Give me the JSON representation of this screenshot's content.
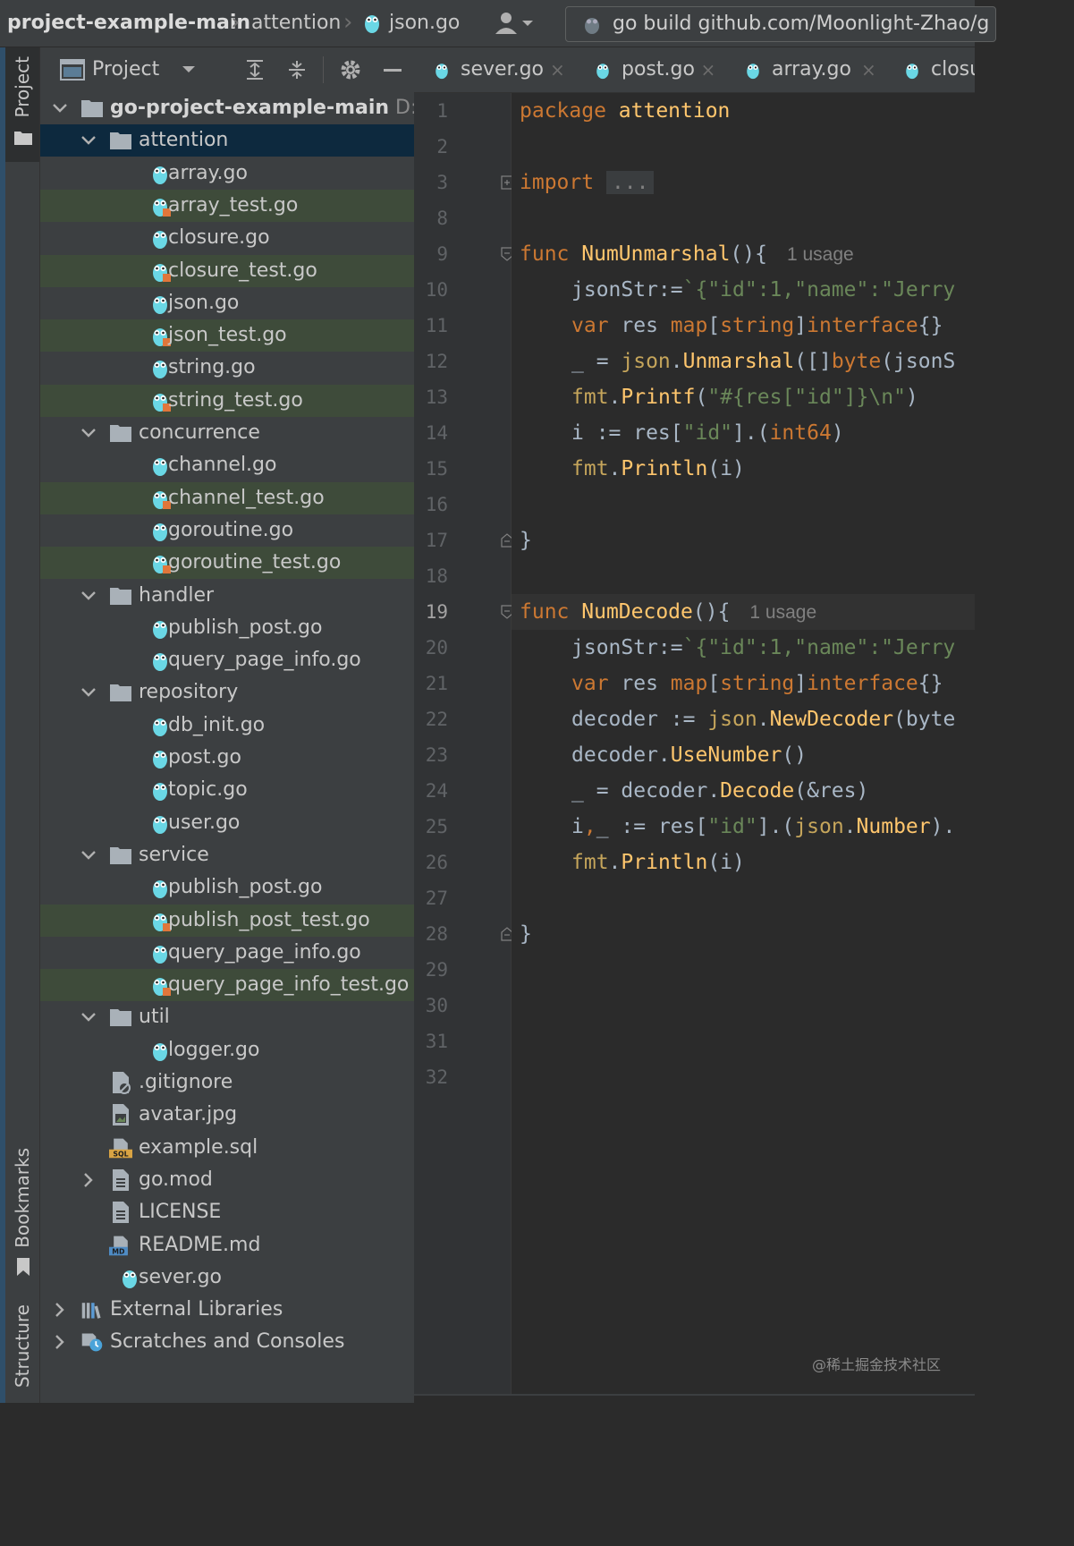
{
  "topbar": {
    "breadcrumbs": [
      "project-example-main",
      "attention",
      "json.go"
    ],
    "run_config": "go build github.com/Moonlight-Zhao/g"
  },
  "toolstrip": {
    "top": [
      "Project"
    ],
    "bottom": [
      "Bookmarks",
      "Structure"
    ]
  },
  "project_panel": {
    "title": "Project",
    "tree": [
      {
        "label": "go-project-example-main",
        "path": "D:\\m",
        "type": "folder",
        "depth": 0,
        "expanded": true,
        "bold": true
      },
      {
        "label": "attention",
        "type": "folder",
        "depth": 1,
        "expanded": true,
        "selected": true
      },
      {
        "label": "array.go",
        "type": "go",
        "depth": 2
      },
      {
        "label": "array_test.go",
        "type": "gotest",
        "depth": 2,
        "green": true
      },
      {
        "label": "closure.go",
        "type": "go",
        "depth": 2
      },
      {
        "label": "closure_test.go",
        "type": "gotest",
        "depth": 2,
        "green": true
      },
      {
        "label": "json.go",
        "type": "go",
        "depth": 2
      },
      {
        "label": "json_test.go",
        "type": "gotest",
        "depth": 2,
        "green": true
      },
      {
        "label": "string.go",
        "type": "go",
        "depth": 2
      },
      {
        "label": "string_test.go",
        "type": "gotest",
        "depth": 2,
        "green": true
      },
      {
        "label": "concurrence",
        "type": "folder",
        "depth": 1,
        "expanded": true
      },
      {
        "label": "channel.go",
        "type": "go",
        "depth": 2
      },
      {
        "label": "channel_test.go",
        "type": "gotest",
        "depth": 2,
        "green": true
      },
      {
        "label": "goroutine.go",
        "type": "go",
        "depth": 2
      },
      {
        "label": "goroutine_test.go",
        "type": "gotest",
        "depth": 2,
        "green": true
      },
      {
        "label": "handler",
        "type": "folder",
        "depth": 1,
        "expanded": true
      },
      {
        "label": "publish_post.go",
        "type": "go",
        "depth": 2
      },
      {
        "label": "query_page_info.go",
        "type": "go",
        "depth": 2
      },
      {
        "label": "repository",
        "type": "folder",
        "depth": 1,
        "expanded": true
      },
      {
        "label": "db_init.go",
        "type": "go",
        "depth": 2
      },
      {
        "label": "post.go",
        "type": "go",
        "depth": 2
      },
      {
        "label": "topic.go",
        "type": "go",
        "depth": 2
      },
      {
        "label": "user.go",
        "type": "go",
        "depth": 2
      },
      {
        "label": "service",
        "type": "folder",
        "depth": 1,
        "expanded": true
      },
      {
        "label": "publish_post.go",
        "type": "go",
        "depth": 2
      },
      {
        "label": "publish_post_test.go",
        "type": "gotest",
        "depth": 2,
        "green": true
      },
      {
        "label": "query_page_info.go",
        "type": "go",
        "depth": 2
      },
      {
        "label": "query_page_info_test.go",
        "type": "gotest",
        "depth": 2,
        "green": true
      },
      {
        "label": "util",
        "type": "folder",
        "depth": 1,
        "expanded": true
      },
      {
        "label": "logger.go",
        "type": "go",
        "depth": 2
      },
      {
        "label": ".gitignore",
        "type": "gitignore",
        "depth": 1
      },
      {
        "label": "avatar.jpg",
        "type": "image",
        "depth": 1
      },
      {
        "label": "example.sql",
        "type": "sql",
        "depth": 1
      },
      {
        "label": "go.mod",
        "type": "file",
        "depth": 1,
        "collapsed": true
      },
      {
        "label": "LICENSE",
        "type": "file",
        "depth": 1
      },
      {
        "label": "README.md",
        "type": "md",
        "depth": 1
      },
      {
        "label": "sever.go",
        "type": "go",
        "depth": 1
      },
      {
        "label": "External Libraries",
        "type": "libs",
        "depth": 0,
        "collapsed": true
      },
      {
        "label": "Scratches and Consoles",
        "type": "scratch",
        "depth": 0,
        "collapsed": true
      }
    ]
  },
  "editor": {
    "tabs": [
      "sever.go",
      "post.go",
      "array.go",
      "closu"
    ],
    "close_glyph": "×",
    "current_line": "19",
    "usage_hint": "1 usage",
    "lines": [
      {
        "n": "1",
        "ind": 0,
        "tokens": [
          [
            "kw",
            "package "
          ],
          [
            "fn",
            "attention"
          ]
        ]
      },
      {
        "n": "2",
        "ind": 0,
        "tokens": []
      },
      {
        "n": "3",
        "ind": 0,
        "fold": "plus",
        "tokens": [
          [
            "kw",
            "import "
          ],
          [
            "collapsed",
            "..."
          ]
        ]
      },
      {
        "n": "8",
        "ind": 0,
        "tokens": []
      },
      {
        "n": "9",
        "ind": 0,
        "fold": "open",
        "hint": true,
        "tokens": [
          [
            "kw",
            "func "
          ],
          [
            "fn",
            "NumUnmarshal"
          ],
          [
            "",
            "(){"
          ]
        ]
      },
      {
        "n": "10",
        "ind": 1,
        "tokens": [
          [
            "",
            "jsonStr:="
          ],
          [
            "st",
            "`{\"id\":1,\"name\":\"Jerry"
          ]
        ]
      },
      {
        "n": "11",
        "ind": 1,
        "tokens": [
          [
            "kw",
            "var "
          ],
          [
            "",
            "res "
          ],
          [
            "ty",
            "map"
          ],
          [
            "",
            "["
          ],
          [
            "ty",
            "string"
          ],
          [
            "",
            "]"
          ],
          [
            "ty",
            "interface"
          ],
          [
            "",
            "{}"
          ]
        ]
      },
      {
        "n": "12",
        "ind": 1,
        "tokens": [
          [
            "",
            "_ = "
          ],
          [
            "mt",
            "json"
          ],
          [
            "",
            "."
          ],
          [
            "fn",
            "Unmarshal"
          ],
          [
            "",
            "([]"
          ],
          [
            "ty",
            "byte"
          ],
          [
            "",
            "(jsonS"
          ]
        ]
      },
      {
        "n": "13",
        "ind": 1,
        "tokens": [
          [
            "mt",
            "fmt"
          ],
          [
            "",
            "."
          ],
          [
            "fn",
            "Printf"
          ],
          [
            "",
            "("
          ],
          [
            "st",
            "\"#{res[\"id\"]}\\n\""
          ],
          [
            "",
            ")"
          ]
        ]
      },
      {
        "n": "14",
        "ind": 1,
        "tokens": [
          [
            "",
            "i := res["
          ],
          [
            "st",
            "\"id\""
          ],
          [
            "",
            "].("
          ],
          [
            "ty",
            "int64"
          ],
          [
            "",
            ")"
          ]
        ]
      },
      {
        "n": "15",
        "ind": 1,
        "tokens": [
          [
            "mt",
            "fmt"
          ],
          [
            "",
            "."
          ],
          [
            "fn",
            "Println"
          ],
          [
            "",
            "(i)"
          ]
        ]
      },
      {
        "n": "16",
        "ind": 0,
        "tokens": []
      },
      {
        "n": "17",
        "ind": 0,
        "fold": "close",
        "tokens": [
          [
            "",
            "}"
          ]
        ]
      },
      {
        "n": "18",
        "ind": 0,
        "tokens": []
      },
      {
        "n": "19",
        "ind": 0,
        "fold": "open",
        "hint": true,
        "tokens": [
          [
            "kw",
            "func "
          ],
          [
            "fn",
            "NumDecode"
          ],
          [
            "",
            "(){"
          ]
        ]
      },
      {
        "n": "20",
        "ind": 1,
        "tokens": [
          [
            "",
            "jsonStr:="
          ],
          [
            "st",
            "`{\"id\":1,\"name\":\"Jerry"
          ]
        ]
      },
      {
        "n": "21",
        "ind": 1,
        "tokens": [
          [
            "kw",
            "var "
          ],
          [
            "",
            "res "
          ],
          [
            "ty",
            "map"
          ],
          [
            "",
            "["
          ],
          [
            "ty",
            "string"
          ],
          [
            "",
            "]"
          ],
          [
            "ty",
            "interface"
          ],
          [
            "",
            "{}"
          ]
        ]
      },
      {
        "n": "22",
        "ind": 1,
        "tokens": [
          [
            "",
            "decoder := "
          ],
          [
            "mt",
            "json"
          ],
          [
            "",
            "."
          ],
          [
            "fn",
            "NewDecoder"
          ],
          [
            "",
            "(byte"
          ]
        ]
      },
      {
        "n": "23",
        "ind": 1,
        "tokens": [
          [
            "",
            "decoder."
          ],
          [
            "fn",
            "UseNumber"
          ],
          [
            "",
            "()"
          ]
        ]
      },
      {
        "n": "24",
        "ind": 1,
        "tokens": [
          [
            "",
            "_ = decoder."
          ],
          [
            "fn",
            "Decode"
          ],
          [
            "",
            "(&res)"
          ]
        ]
      },
      {
        "n": "25",
        "ind": 1,
        "tokens": [
          [
            "",
            "i"
          ],
          [
            "kw",
            ","
          ],
          [
            "",
            "_ := res["
          ],
          [
            "st",
            "\"id\""
          ],
          [
            "",
            "].("
          ],
          [
            "mt",
            "json"
          ],
          [
            "",
            "."
          ],
          [
            "fn",
            "Number"
          ],
          [
            "",
            ")."
          ]
        ]
      },
      {
        "n": "26",
        "ind": 1,
        "tokens": [
          [
            "mt",
            "fmt"
          ],
          [
            "",
            "."
          ],
          [
            "fn",
            "Println"
          ],
          [
            "",
            "(i)"
          ]
        ]
      },
      {
        "n": "27",
        "ind": 0,
        "tokens": []
      },
      {
        "n": "28",
        "ind": 0,
        "fold": "close",
        "tokens": [
          [
            "",
            "}"
          ]
        ]
      },
      {
        "n": "29",
        "ind": 0,
        "tokens": []
      },
      {
        "n": "30",
        "ind": 0,
        "tokens": []
      },
      {
        "n": "31",
        "ind": 0,
        "tokens": []
      },
      {
        "n": "32",
        "ind": 0,
        "tokens": []
      }
    ]
  },
  "watermark": "@稀土掘金技术社区",
  "colors": {
    "green_row": "#3e4b3a",
    "selected_row": "#0d293e",
    "keyword": "#cc7832",
    "function": "#ffc66d",
    "string": "#6a8759"
  }
}
